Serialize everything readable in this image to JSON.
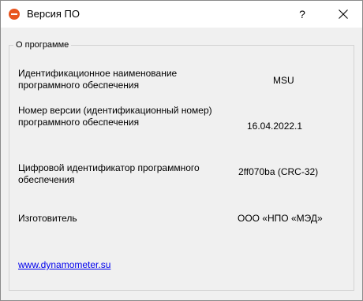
{
  "window": {
    "title": "Версия ПО",
    "help_glyph": "?",
    "accent": "#e8541e"
  },
  "group": {
    "title": "О программе"
  },
  "rows": [
    {
      "label": "Идентификационное наименование программного обеспечения",
      "value": "MSU"
    },
    {
      "label": "Номер версии (идентификационный номер) программного обеспечения",
      "value": "16.04.2022.1"
    },
    {
      "label": "Цифровой идентификатор программного обеспечения",
      "value": "2ff070ba (CRC-32)"
    },
    {
      "label": "Изготовитель",
      "value": "ООО «НПО «МЭД»"
    }
  ],
  "link": {
    "text": "www.dynamometer.su",
    "color": "#0000ee"
  }
}
